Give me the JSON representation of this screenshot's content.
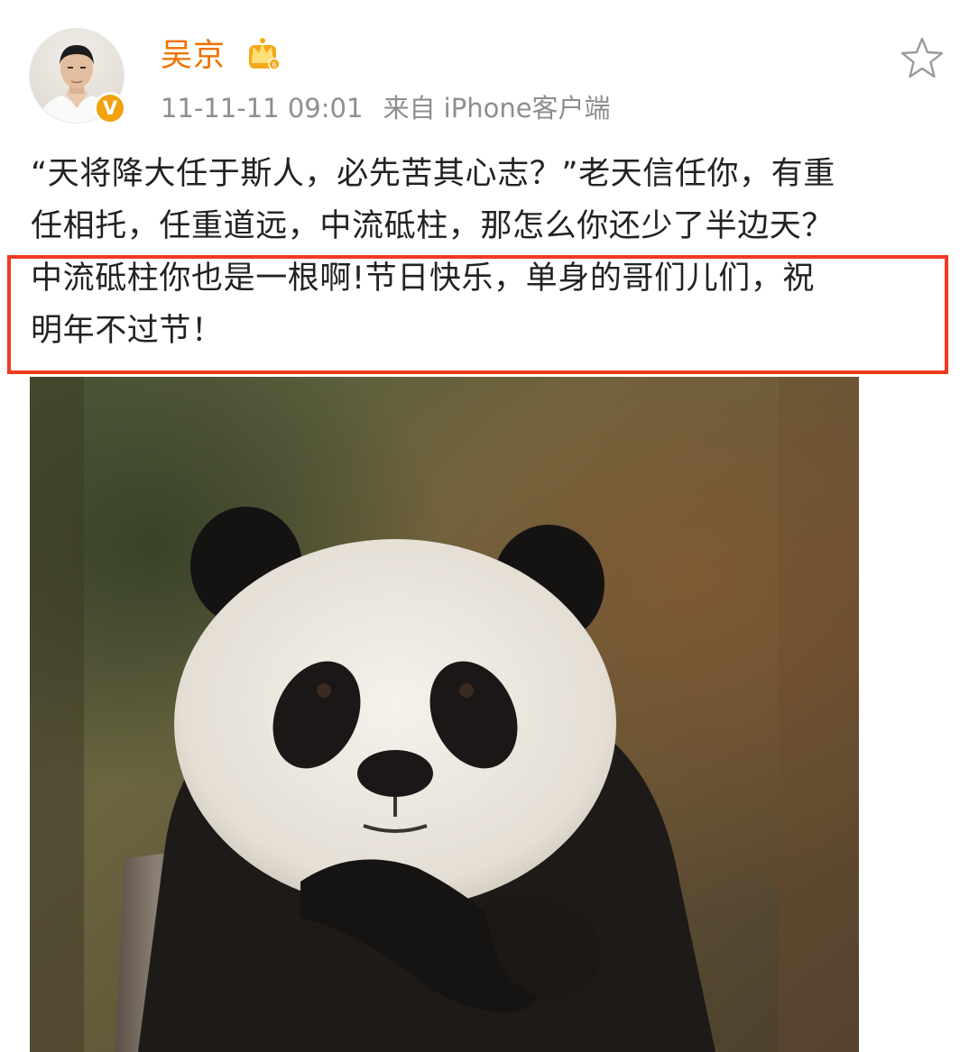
{
  "post": {
    "author": {
      "name": "吴京",
      "avatar_icon": "user-avatar",
      "verified_badge": "V",
      "member_badge_icon": "crown-level-icon"
    },
    "timestamp": "11-11-11 09:01",
    "source": "来自 iPhone客户端",
    "favorite_icon": "star-outline-icon",
    "text_lines": [
      "“天将降大任于斯人，必先苦其心志？”老天信任你，有重",
      "任相托，任重道远，中流砥柱，那怎么你还少了半边天？",
      "中流砥柱你也是一根啊!节日快乐，单身的哥们儿们，祝",
      "明年不过节！"
    ],
    "highlight_color": "#f03a20",
    "image": {
      "subject": "panda-photo",
      "alt": "panda"
    }
  },
  "colors": {
    "username": "#f07200",
    "meta": "#8e8e8e",
    "verified": "#f2a10f",
    "highlight": "#f03a20"
  }
}
